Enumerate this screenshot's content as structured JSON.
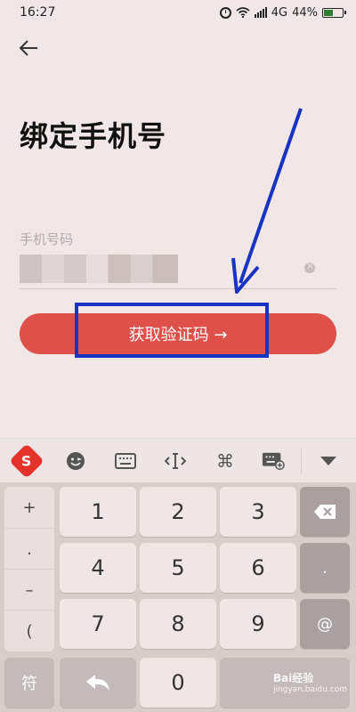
{
  "status_bar": {
    "time": "16:27",
    "network": "4G",
    "battery": "44%"
  },
  "page": {
    "title": "绑定手机号"
  },
  "phone": {
    "label": "手机号码"
  },
  "actions": {
    "get_code_label": "获取验证码 →"
  },
  "keyboard": {
    "symbols": [
      "+",
      ".",
      "–",
      "("
    ],
    "digits": [
      "1",
      "2",
      "3",
      "4",
      "5",
      "6",
      "7",
      "8",
      "9",
      "0"
    ],
    "bottom_left": "符",
    "right_keys": [
      ".",
      "@"
    ],
    "watermark_main": "Bai经验",
    "watermark_sub": "jingyan.baidu.com"
  },
  "colors": {
    "accent": "#e0504a",
    "highlight": "#1733c4",
    "background": "#f1e7e6"
  }
}
